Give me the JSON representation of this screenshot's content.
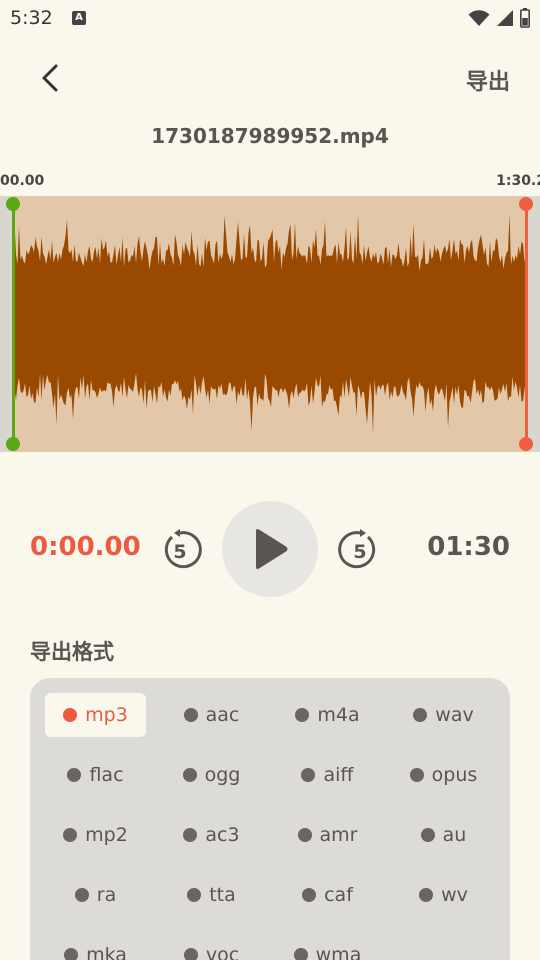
{
  "status_bar": {
    "time": "5:32",
    "notification_icon": "A",
    "icons": [
      "wifi-icon",
      "signal-icon",
      "battery-icon"
    ]
  },
  "app_bar": {
    "back_icon": "chevron-left-icon",
    "export_label": "导出"
  },
  "file": {
    "name": "1730187989952.mp4"
  },
  "waveform": {
    "start_label": "00.00",
    "end_label": "1:30.2",
    "selection_start_fraction": 0.0,
    "selection_end_fraction": 1.0,
    "wave_color": "#9a4a00",
    "region_color": "#e2c7a9",
    "start_handle_color": "#5aa814",
    "end_handle_color": "#f06040"
  },
  "playback": {
    "current_time": "0:00.00",
    "rewind_seconds": "5",
    "forward_seconds": "5",
    "total_time": "01:30",
    "accent_color": "#ee5a3f"
  },
  "formats": {
    "title": "导出格式",
    "selected": "mp3",
    "items": [
      "mp3",
      "aac",
      "m4a",
      "wav",
      "flac",
      "ogg",
      "aiff",
      "opus",
      "mp2",
      "ac3",
      "amr",
      "au",
      "ra",
      "tta",
      "caf",
      "wv",
      "mka",
      "voc",
      "wma"
    ]
  }
}
